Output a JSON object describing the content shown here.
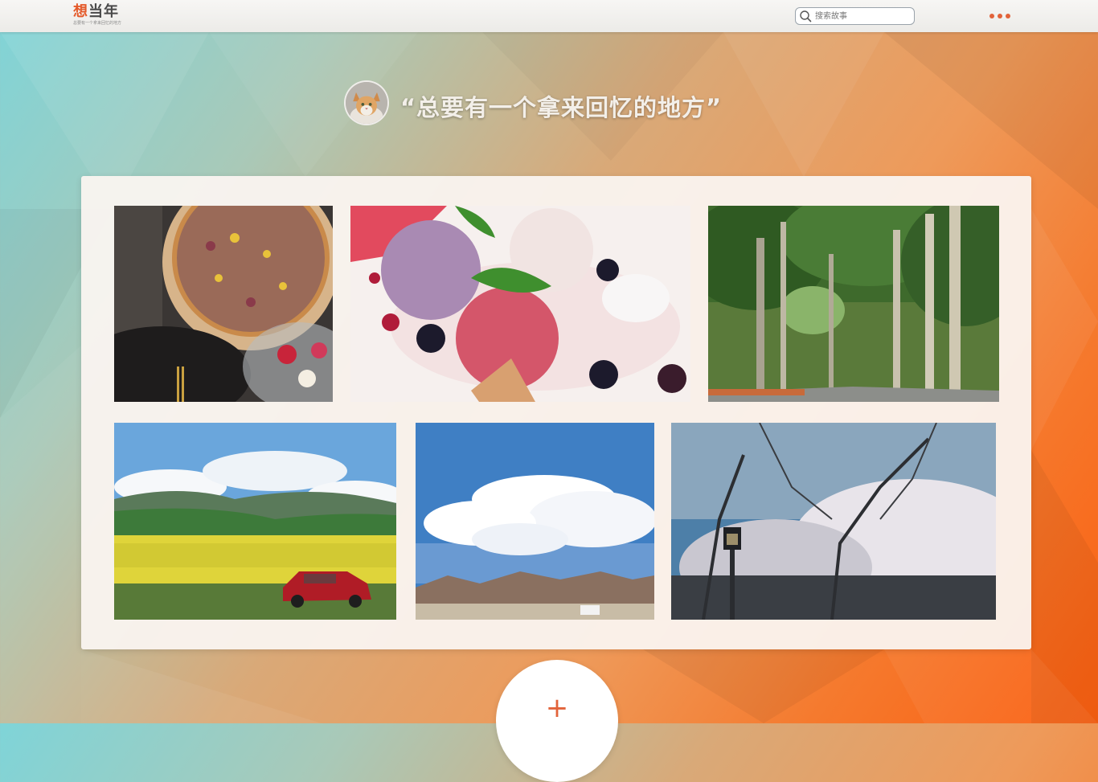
{
  "header": {
    "logo_text": "想当年",
    "logo_tagline": "总要有一个拿来回忆的地方",
    "search_placeholder": "搜索故事"
  },
  "hero": {
    "quote": "“总要有一个拿来回忆的地方”"
  },
  "gallery": {
    "photos": [
      {
        "subject": "pizza"
      },
      {
        "subject": "ice-cream"
      },
      {
        "subject": "tree-lined-road"
      },
      {
        "subject": "mountain-meadow-with-car"
      },
      {
        "subject": "desert-sky-clouds"
      },
      {
        "subject": "cherry-blossom-lamp"
      }
    ]
  },
  "add_button": {
    "label": "+"
  },
  "colors": {
    "accent": "#e2633a",
    "card": "#faf4f0"
  }
}
